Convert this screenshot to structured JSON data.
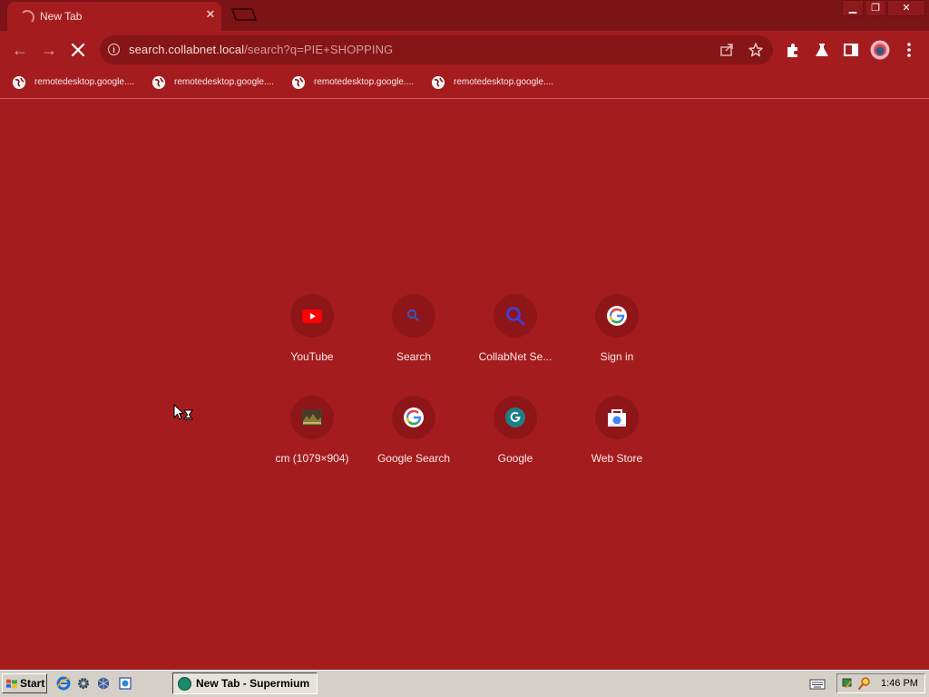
{
  "window": {
    "tab_title": "New Tab",
    "tab_close": "✕",
    "controls": {
      "minimize": "▁",
      "restore": "❐",
      "close": "✕"
    }
  },
  "toolbar": {
    "url_host": "search.collabnet.local",
    "url_rest": "/search?q=PIE+SHOPPING",
    "info_glyph": "i"
  },
  "bookmarks": [
    {
      "label": "remotedesktop.google....",
      "icon": "globe-icon"
    },
    {
      "label": "remotedesktop.google....",
      "icon": "globe-icon"
    },
    {
      "label": "remotedesktop.google....",
      "icon": "globe-icon"
    },
    {
      "label": "remotedesktop.google....",
      "icon": "globe-icon"
    }
  ],
  "shortcuts": [
    {
      "label": "YouTube",
      "icon": "youtube-icon"
    },
    {
      "label": "Search",
      "icon": "search-icon"
    },
    {
      "label": "CollabNet Se...",
      "icon": "search-icon"
    },
    {
      "label": "Sign in",
      "icon": "google-icon"
    },
    {
      "label": "cm (1079×904)",
      "icon": "image-thumbnail-icon"
    },
    {
      "label": "Google Search",
      "icon": "google-icon"
    },
    {
      "label": "Google",
      "icon": "google-g-icon"
    },
    {
      "label": "Web Store",
      "icon": "web-store-icon"
    }
  ],
  "taskbar": {
    "start_label": "Start",
    "task_label": "New Tab - Supermium",
    "clock": "1:46 PM"
  },
  "colors": {
    "theme_background": "#a51c1f",
    "frame": "#7c1317",
    "omnibox": "#861518",
    "tile": "#8f1618",
    "taskbar": "#d4d0c8"
  }
}
